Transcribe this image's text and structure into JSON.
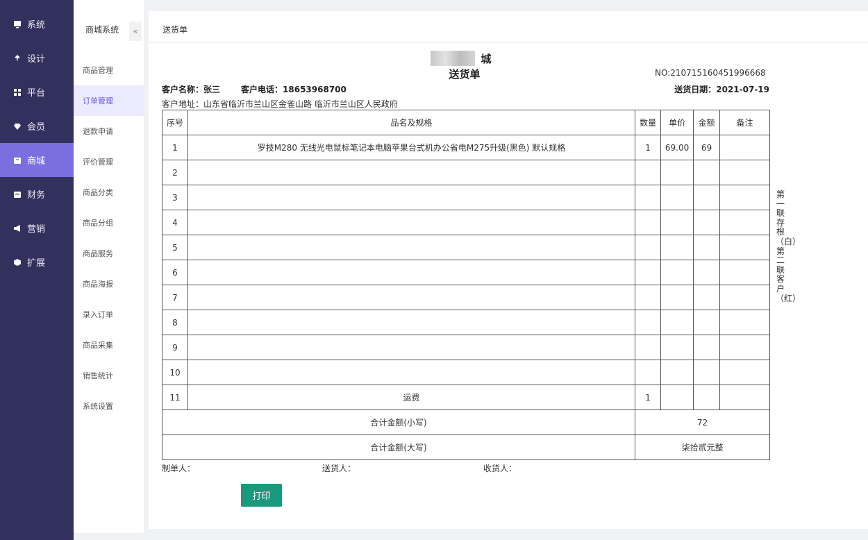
{
  "sidebar": {
    "items": [
      {
        "label": "系统",
        "icon": "system-icon"
      },
      {
        "label": "设计",
        "icon": "pin-icon"
      },
      {
        "label": "平台",
        "icon": "grid-icon"
      },
      {
        "label": "会员",
        "icon": "diamond-icon"
      },
      {
        "label": "商城",
        "icon": "mall-icon",
        "active": true
      },
      {
        "label": "财务",
        "icon": "wallet-icon"
      },
      {
        "label": "营销",
        "icon": "megaphone-icon"
      },
      {
        "label": "扩展",
        "icon": "cube-icon"
      }
    ]
  },
  "subnav": {
    "title": "商城系统",
    "collapse": "«",
    "items": [
      "商品管理",
      "订单管理",
      "退款申请",
      "评价管理",
      "商品分类",
      "商品分组",
      "商品服务",
      "商品海报",
      "录入订单",
      "商品采集",
      "销售统计",
      "系统设置"
    ],
    "active_index": 1
  },
  "breadcrumb": "送货单",
  "doc": {
    "shop_name_visible": "城",
    "title": "送货单",
    "no": "NO:210715160451996668",
    "customer_name": "客户名称：张三",
    "customer_phone": "客户电话：18653968700",
    "delivery_date": "送货日期：2021-07-19",
    "address": "客户地址：山东省临沂市兰山区金雀山路 临沂市兰山区人民政府",
    "columns": [
      "序号",
      "品名及规格",
      "数量",
      "单价",
      "金额",
      "备注"
    ],
    "rows": [
      {
        "no": "1",
        "name": "罗技M280 无线光电鼠标笔记本电脑苹果台式机办公省电M275升级(黑色) 默认规格",
        "qty": "1",
        "price": "69.00",
        "amount": "69",
        "note": ""
      },
      {
        "no": "2",
        "name": "",
        "qty": "",
        "price": "",
        "amount": "",
        "note": ""
      },
      {
        "no": "3",
        "name": "",
        "qty": "",
        "price": "",
        "amount": "",
        "note": ""
      },
      {
        "no": "4",
        "name": "",
        "qty": "",
        "price": "",
        "amount": "",
        "note": ""
      },
      {
        "no": "5",
        "name": "",
        "qty": "",
        "price": "",
        "amount": "",
        "note": ""
      },
      {
        "no": "6",
        "name": "",
        "qty": "",
        "price": "",
        "amount": "",
        "note": ""
      },
      {
        "no": "7",
        "name": "",
        "qty": "",
        "price": "",
        "amount": "",
        "note": ""
      },
      {
        "no": "8",
        "name": "",
        "qty": "",
        "price": "",
        "amount": "",
        "note": ""
      },
      {
        "no": "9",
        "name": "",
        "qty": "",
        "price": "",
        "amount": "",
        "note": ""
      },
      {
        "no": "10",
        "name": "",
        "qty": "",
        "price": "",
        "amount": "",
        "note": ""
      },
      {
        "no": "11",
        "name": "运费",
        "qty": "1",
        "price": "",
        "amount": "",
        "note": ""
      }
    ],
    "total_small_label": "合计金额(小写)",
    "total_small": "72",
    "total_big_label": "合计金额(大写)",
    "total_big": "柒拾贰元整",
    "side_note": "第一联存根（白）第二联客户（红）",
    "maker": "制单人：",
    "deliverer": "送货人：",
    "receiver": "收货人：",
    "print_button": "打印"
  },
  "colors": {
    "sidebar": "#32305c",
    "sidebar_active": "#7b6fe0",
    "button": "#1a9a7c"
  }
}
